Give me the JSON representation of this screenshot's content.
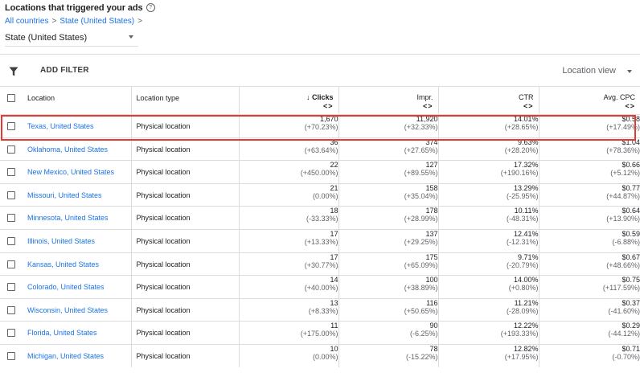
{
  "header": {
    "title": "Locations that triggered your ads",
    "help_icon": "?",
    "breadcrumb": [
      "All countries",
      "State (United States)"
    ],
    "breadcrumb_separator": ">",
    "select_value": "State (United States)"
  },
  "toolbar": {
    "add_filter_label": "ADD FILTER",
    "view_label": "Location view"
  },
  "table": {
    "columns": {
      "location": "Location",
      "location_type": "Location type",
      "clicks": "Clicks",
      "clicks_sort_icon": "↓",
      "impr": "Impr.",
      "ctr": "CTR",
      "cpc": "Avg. CPC",
      "sort_arrows": "<>"
    },
    "rows": [
      {
        "location": "Texas, United States",
        "type": "Physical location",
        "clicks": "1,670",
        "clicks_delta": "(+70.23%)",
        "impr": "11,920",
        "impr_delta": "(+32.33%)",
        "ctr": "14.01%",
        "ctr_delta": "(+28.65%)",
        "cpc": "$0.58",
        "cpc_delta": "(+17.49%)"
      },
      {
        "location": "Oklahoma, United States",
        "type": "Physical location",
        "clicks": "36",
        "clicks_delta": "(+63.64%)",
        "impr": "374",
        "impr_delta": "(+27.65%)",
        "ctr": "9.63%",
        "ctr_delta": "(+28.20%)",
        "cpc": "$1.04",
        "cpc_delta": "(+78.36%)"
      },
      {
        "location": "New Mexico, United States",
        "type": "Physical location",
        "clicks": "22",
        "clicks_delta": "(+450.00%)",
        "impr": "127",
        "impr_delta": "(+89.55%)",
        "ctr": "17.32%",
        "ctr_delta": "(+190.16%)",
        "cpc": "$0.66",
        "cpc_delta": "(+5.12%)"
      },
      {
        "location": "Missouri, United States",
        "type": "Physical location",
        "clicks": "21",
        "clicks_delta": "(0.00%)",
        "impr": "158",
        "impr_delta": "(+35.04%)",
        "ctr": "13.29%",
        "ctr_delta": "(-25.95%)",
        "cpc": "$0.77",
        "cpc_delta": "(+44.87%)"
      },
      {
        "location": "Minnesota, United States",
        "type": "Physical location",
        "clicks": "18",
        "clicks_delta": "(-33.33%)",
        "impr": "178",
        "impr_delta": "(+28.99%)",
        "ctr": "10.11%",
        "ctr_delta": "(-48.31%)",
        "cpc": "$0.64",
        "cpc_delta": "(+13.90%)"
      },
      {
        "location": "Illinois, United States",
        "type": "Physical location",
        "clicks": "17",
        "clicks_delta": "(+13.33%)",
        "impr": "137",
        "impr_delta": "(+29.25%)",
        "ctr": "12.41%",
        "ctr_delta": "(-12.31%)",
        "cpc": "$0.59",
        "cpc_delta": "(-6.88%)"
      },
      {
        "location": "Kansas, United States",
        "type": "Physical location",
        "clicks": "17",
        "clicks_delta": "(+30.77%)",
        "impr": "175",
        "impr_delta": "(+65.09%)",
        "ctr": "9.71%",
        "ctr_delta": "(-20.79%)",
        "cpc": "$0.67",
        "cpc_delta": "(+48.66%)"
      },
      {
        "location": "Colorado, United States",
        "type": "Physical location",
        "clicks": "14",
        "clicks_delta": "(+40.00%)",
        "impr": "100",
        "impr_delta": "(+38.89%)",
        "ctr": "14.00%",
        "ctr_delta": "(+0.80%)",
        "cpc": "$0.75",
        "cpc_delta": "(+117.59%)"
      },
      {
        "location": "Wisconsin, United States",
        "type": "Physical location",
        "clicks": "13",
        "clicks_delta": "(+8.33%)",
        "impr": "116",
        "impr_delta": "(+50.65%)",
        "ctr": "11.21%",
        "ctr_delta": "(-28.09%)",
        "cpc": "$0.37",
        "cpc_delta": "(-41.60%)"
      },
      {
        "location": "Florida, United States",
        "type": "Physical location",
        "clicks": "11",
        "clicks_delta": "(+175.00%)",
        "impr": "90",
        "impr_delta": "(-6.25%)",
        "ctr": "12.22%",
        "ctr_delta": "(+193.33%)",
        "cpc": "$0.29",
        "cpc_delta": "(-44.12%)"
      },
      {
        "location": "Michigan, United States",
        "type": "Physical location",
        "clicks": "10",
        "clicks_delta": "(0.00%)",
        "impr": "78",
        "impr_delta": "(-15.22%)",
        "ctr": "12.82%",
        "ctr_delta": "(+17.95%)",
        "cpc": "$0.71",
        "cpc_delta": "(-0.70%)"
      }
    ]
  },
  "colors": {
    "link": "#1a73e8",
    "highlight": "#e53935",
    "text": "#202124",
    "muted": "#5f6368",
    "border": "#dadce0"
  }
}
